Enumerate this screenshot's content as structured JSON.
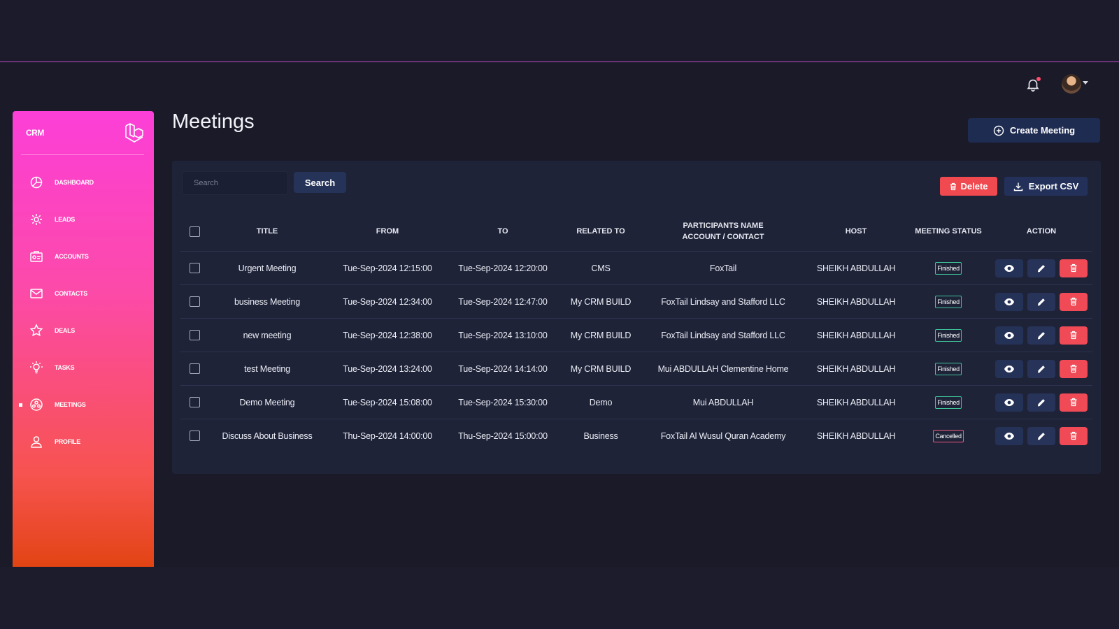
{
  "brand": "CRM",
  "sidebar": {
    "items": [
      {
        "label": "DASHBOARD",
        "icon": "dashboard-icon"
      },
      {
        "label": "LEADS",
        "icon": "leads-icon"
      },
      {
        "label": "ACCOUNTS",
        "icon": "accounts-icon"
      },
      {
        "label": "CONTACTS",
        "icon": "contacts-icon"
      },
      {
        "label": "DEALS",
        "icon": "deals-icon"
      },
      {
        "label": "TASKS",
        "icon": "tasks-icon"
      },
      {
        "label": "MEETINGS",
        "icon": "meetings-icon",
        "active": true
      },
      {
        "label": "PROFILE",
        "icon": "profile-icon"
      }
    ]
  },
  "page": {
    "title": "Meetings",
    "create_label": "Create Meeting"
  },
  "toolbar": {
    "search_placeholder": "Search",
    "search_label": "Search",
    "delete_label": "Delete",
    "export_label": "Export CSV"
  },
  "table": {
    "headers": {
      "title": "TITLE",
      "from": "FROM",
      "to": "TO",
      "related": "RELATED TO",
      "participants_1": "PARTICIPANTS NAME",
      "participants_2": "ACCOUNT / CONTACT",
      "host": "HOST",
      "status": "MEETING STATUS",
      "action": "ACTION"
    },
    "rows": [
      {
        "title": "Urgent Meeting",
        "from": "Tue-Sep-2024 12:15:00",
        "to": "Tue-Sep-2024 12:20:00",
        "related": "CMS",
        "participants": "FoxTail",
        "host": "SHEIKH ABDULLAH",
        "status": "Finished"
      },
      {
        "title": "business Meeting",
        "from": "Tue-Sep-2024 12:34:00",
        "to": "Tue-Sep-2024 12:47:00",
        "related": "My CRM BUILD",
        "participants": "FoxTail Lindsay and Stafford LLC",
        "host": "SHEIKH ABDULLAH",
        "status": "Finished"
      },
      {
        "title": "new meeting",
        "from": "Tue-Sep-2024 12:38:00",
        "to": "Tue-Sep-2024 13:10:00",
        "related": "My CRM BUILD",
        "participants": "FoxTail Lindsay and Stafford LLC",
        "host": "SHEIKH ABDULLAH",
        "status": "Finished"
      },
      {
        "title": "test Meeting",
        "from": "Tue-Sep-2024 13:24:00",
        "to": "Tue-Sep-2024 14:14:00",
        "related": "My CRM BUILD",
        "participants": "Mui ABDULLAH Clementine Home",
        "host": "SHEIKH ABDULLAH",
        "status": "Finished"
      },
      {
        "title": "Demo Meeting",
        "from": "Tue-Sep-2024 15:08:00",
        "to": "Tue-Sep-2024 15:30:00",
        "related": "Demo",
        "participants": "Mui ABDULLAH",
        "host": "SHEIKH ABDULLAH",
        "status": "Finished"
      },
      {
        "title": "Discuss About Business",
        "from": "Thu-Sep-2024 14:00:00",
        "to": "Thu-Sep-2024 15:00:00",
        "related": "Business",
        "participants": "FoxTail Al Wusul Quran Academy",
        "host": "SHEIKH ABDULLAH",
        "status": "Cancelled"
      }
    ]
  },
  "colors": {
    "finished": "#3fc49a",
    "cancelled": "#f05a7b",
    "delete": "#ef4a55",
    "accent": "#fc3fd8"
  }
}
